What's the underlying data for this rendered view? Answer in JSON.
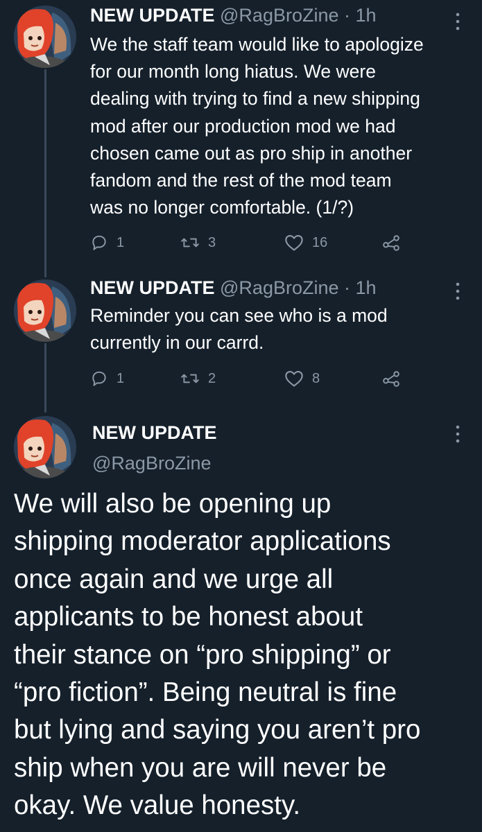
{
  "colors": {
    "background": "#15202b",
    "text_primary": "#ffffff",
    "text_secondary": "#8b98a5",
    "thread_line": "#3a4a5a"
  },
  "tweets": [
    {
      "display_name": "NEW UPDATE",
      "handle": "@RagBroZine",
      "separator": "·",
      "time": "1h",
      "text": "We the staff team would like to apologize\nfor our month long hiatus. We were\ndealing with trying to find a new shipping\nmod after our production mod we had\nchosen came out as pro ship in another\nfandom and the rest of the mod team\nwas no longer comfortable. (1/?)",
      "replies": "1",
      "retweets": "3",
      "likes": "16"
    },
    {
      "display_name": "NEW UPDATE",
      "handle": "@RagBroZine",
      "separator": "·",
      "time": "1h",
      "text": "Reminder you can see who is a mod\ncurrently in our carrd.",
      "replies": "1",
      "retweets": "2",
      "likes": "8"
    }
  ],
  "focused_tweet": {
    "display_name": "NEW UPDATE",
    "handle": "@RagBroZine",
    "text": "We will also be opening up\nshipping moderator applications\nonce again and we urge all\napplicants to be honest about\ntheir stance on “pro shipping” or\n“pro fiction”. Being neutral is fine\nbut lying and saying you aren’t pro\nship when you are will never be\nokay. We value honesty."
  },
  "icons": {
    "reply": "reply-icon",
    "retweet": "retweet-icon",
    "like": "heart-icon",
    "share": "share-icon",
    "more": "more-options-icon"
  }
}
